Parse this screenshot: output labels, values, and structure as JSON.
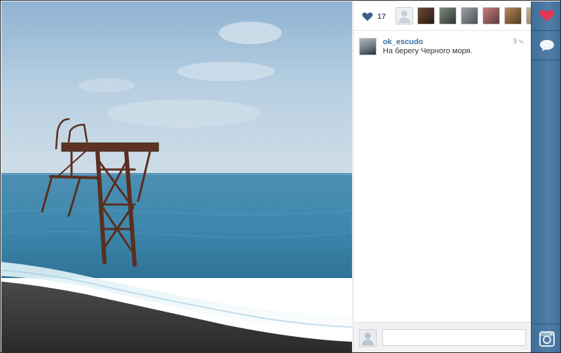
{
  "photo": {
    "subject": "sea-with-ruined-diving-tower"
  },
  "likes": {
    "count": "17",
    "icon": "heart-icon",
    "likers": [
      "liker-avatar-placeholder",
      "liker-avatar-1",
      "liker-avatar-2",
      "liker-avatar-3",
      "liker-avatar-4",
      "liker-avatar-5",
      "liker-avatar-6"
    ]
  },
  "caption": {
    "username": "ok_escudo",
    "time": "9 ч.",
    "text": "На берегу Черного моря."
  },
  "comment_box": {
    "placeholder": ""
  },
  "sidebar": {
    "like_icon": "heart-icon",
    "comment_icon": "speech-bubble-icon",
    "instagram_icon": "camera-icon"
  },
  "colors": {
    "link": "#3f6ea3",
    "sidebar": "#4a78a3",
    "like_heart": "#e5344f"
  }
}
